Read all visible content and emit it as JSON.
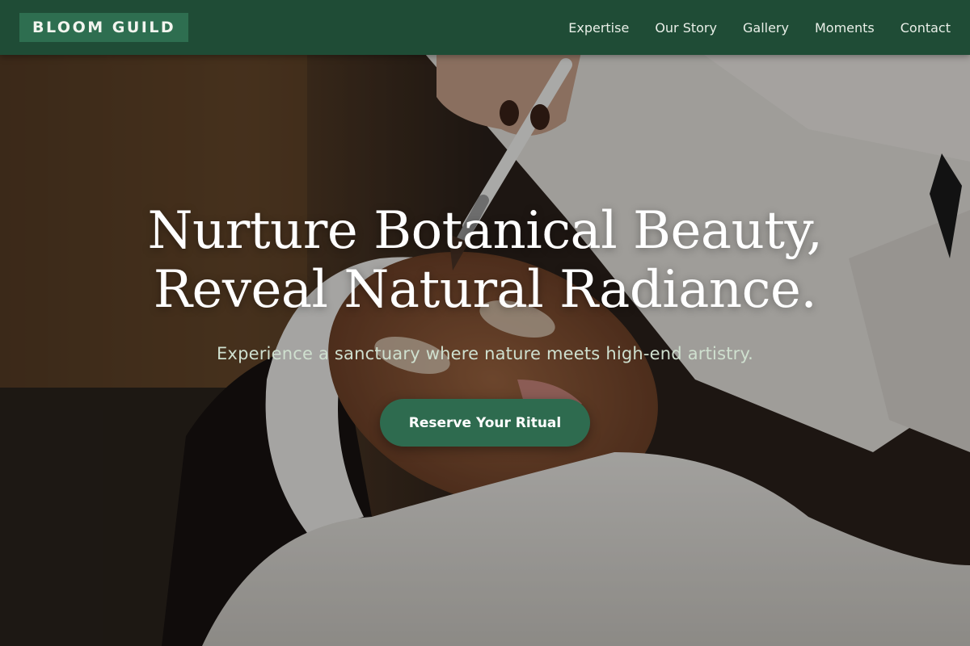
{
  "brand": {
    "name": "BLOOM GUILD"
  },
  "nav": {
    "items": [
      {
        "label": "Expertise"
      },
      {
        "label": "Our Story"
      },
      {
        "label": "Gallery"
      },
      {
        "label": "Moments"
      },
      {
        "label": "Contact"
      }
    ]
  },
  "hero": {
    "headline_line1": "Nurture Botanical Beauty,",
    "headline_line2": "Reveal Natural Radiance.",
    "subheadline": "Experience a sanctuary where nature meets high-end artistry.",
    "cta_label": "Reserve Your Ritual",
    "image_subject": "facial-treatment-photo"
  },
  "colors": {
    "header_bg": "#1f4c36",
    "logo_bg": "#2e6e50",
    "cta_bg": "#2e6b4f",
    "subheadline_text": "#cfe0cf",
    "headline_text": "#ffffff"
  }
}
